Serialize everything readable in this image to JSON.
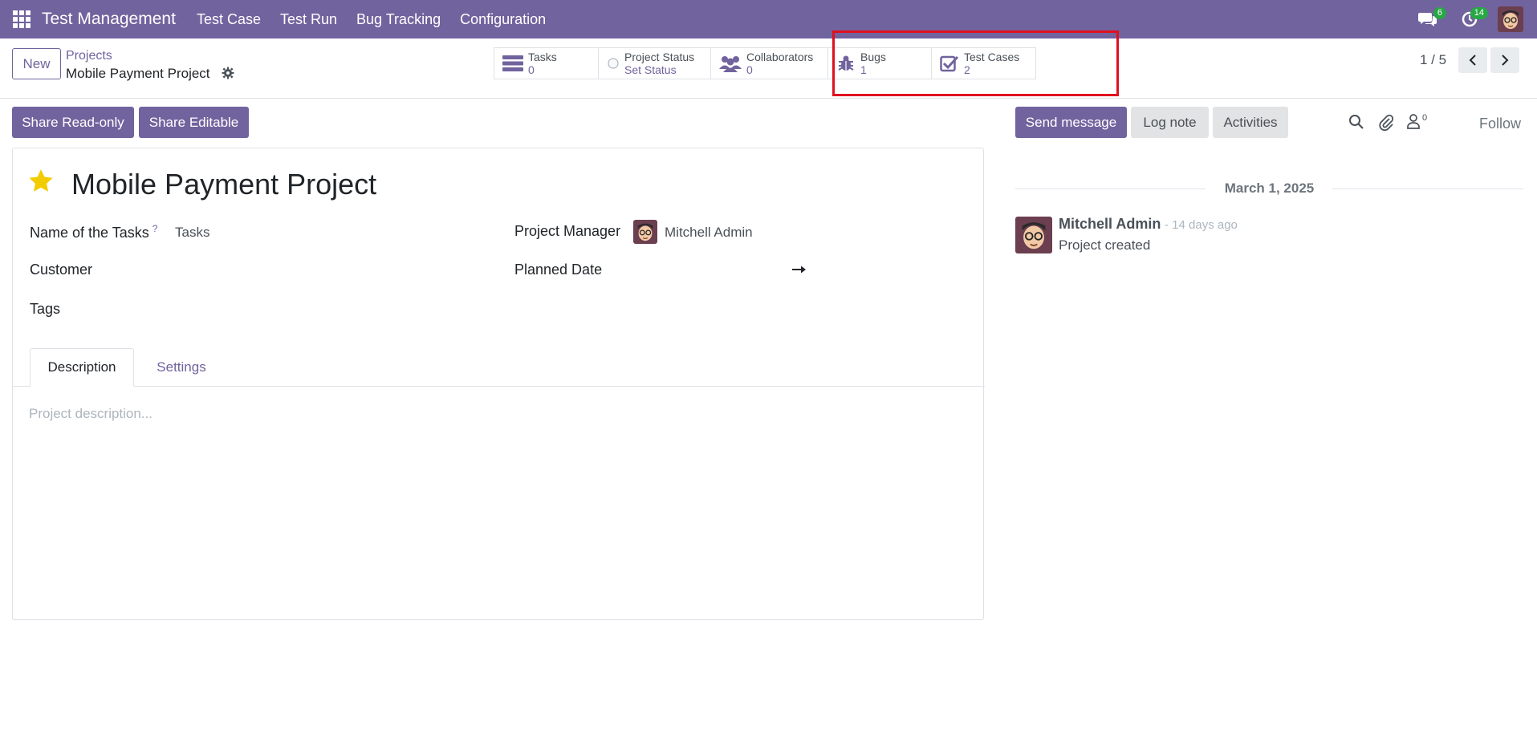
{
  "navbar": {
    "brand": "Test Management",
    "menu": [
      "Test Case",
      "Test Run",
      "Bug Tracking",
      "Configuration"
    ],
    "messages_count": "6",
    "activities_count": "14",
    "bg_color": "#71639e"
  },
  "control_panel": {
    "new_label": "New",
    "breadcrumb_parent": "Projects",
    "breadcrumb_current": "Mobile Payment Project",
    "smart_buttons": {
      "tasks": {
        "label": "Tasks",
        "value": "0",
        "icon": "tasks-icon"
      },
      "status": {
        "label": "Project Status",
        "value": "Set Status",
        "icon": "status-dot-icon"
      },
      "collaborators": {
        "label": "Collaborators",
        "value": "0",
        "icon": "users-icon"
      },
      "bugs": {
        "label": "Bugs",
        "value": "1",
        "icon": "bug-icon"
      },
      "test_cases": {
        "label": "Test Cases",
        "value": "2",
        "icon": "checkbox-icon"
      }
    },
    "pager": "1 / 5",
    "highlight_color": "#e0101d"
  },
  "actions": {
    "share_readonly": "Share Read-only",
    "share_editable": "Share Editable"
  },
  "form": {
    "title": "Mobile Payment Project",
    "name_of_tasks_label": "Name of the Tasks",
    "name_of_tasks_tooltip": "?",
    "name_of_tasks_value": "Tasks",
    "customer_label": "Customer",
    "tags_label": "Tags",
    "project_manager_label": "Project Manager",
    "project_manager_value": "Mitchell Admin",
    "planned_date_label": "Planned Date",
    "tabs": [
      "Description",
      "Settings"
    ],
    "description_placeholder": "Project description..."
  },
  "chatter": {
    "send_message": "Send message",
    "log_note": "Log note",
    "activities": "Activities",
    "followers_count": "0",
    "follow": "Follow",
    "date": "March 1, 2025",
    "message": {
      "author": "Mitchell Admin",
      "time": "- 14 days ago",
      "body": "Project created"
    }
  }
}
